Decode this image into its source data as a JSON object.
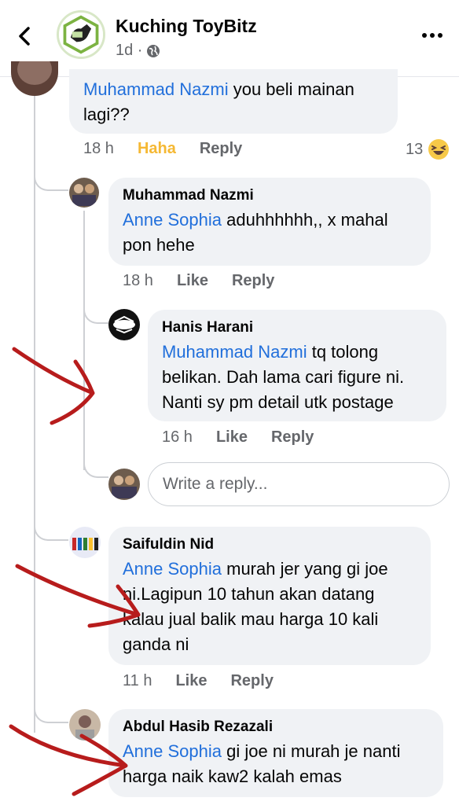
{
  "header": {
    "page_name": "Kuching ToyBitz",
    "post_age": "1d ·"
  },
  "comments": [
    {
      "id": "c0",
      "mention": "Muhammad Nazmi",
      "text_line1_rest": " you beli mainan",
      "text_line2": "lagi??",
      "time": "18 h",
      "reaction_action": "Haha",
      "reply": "Reply",
      "reaction_count": "13"
    },
    {
      "id": "c1",
      "author": "Muhammad Nazmi",
      "mention": "Anne Sophia",
      "text_line1_rest": " aduhhhhhh,, x mahal",
      "text_line2": "pon hehe",
      "time": "18 h",
      "like": "Like",
      "reply": "Reply"
    },
    {
      "id": "c2",
      "author": "Hanis Harani",
      "mention": "Muhammad Nazmi",
      "text_line1_rest": " tq tolong",
      "text_line2": "belikan. Dah lama cari figure ni.",
      "text_line3": "Nanti sy pm detail utk postage",
      "time": "16 h",
      "like": "Like",
      "reply": "Reply"
    },
    {
      "id": "c3",
      "author": "Saifuldin Nid",
      "mention": "Anne Sophia",
      "text_line1_rest": " murah jer yang gi joe",
      "text_line2": "ni.Lagipun 10 tahun akan datang",
      "text_line3": "kalau jual balik mau harga 10 kali",
      "text_line4": "ganda ni",
      "time": "11 h",
      "like": "Like",
      "reply": "Reply"
    },
    {
      "id": "c4",
      "author": "Abdul Hasib Rezazali",
      "mention": "Anne Sophia",
      "text_line1_rest": " gi joe ni murah je nanti",
      "text_line2": "harga naik kaw2 kalah emas"
    }
  ],
  "reply_box": {
    "placeholder": "Write a reply..."
  },
  "colors": {
    "mention": "#216fdb",
    "bubble": "#f0f2f5",
    "muted": "#65676b",
    "haha": "#f5b833",
    "annotation_arrow": "#b71c1c"
  },
  "icons": [
    "back-arrow-icon",
    "globe-icon",
    "more-options-icon",
    "haha-emoji-icon"
  ]
}
